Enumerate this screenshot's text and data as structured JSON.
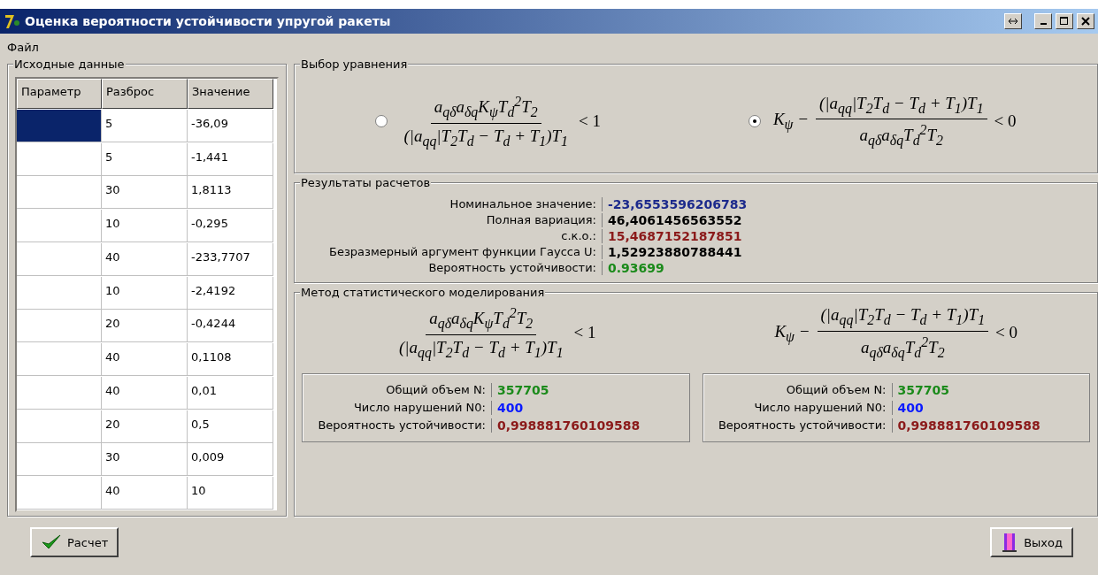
{
  "window": {
    "title": "Оценка вероятности устойчивости упругой ракеты"
  },
  "menu": [
    "Файл"
  ],
  "input_group": {
    "title": "Исходные данные",
    "columns": [
      "Параметр",
      "Разброс",
      "Значение"
    ],
    "rows": [
      {
        "spread": "5",
        "value": "-36,09",
        "selected": true
      },
      {
        "spread": "5",
        "value": "-1,441",
        "selected": false
      },
      {
        "spread": "30",
        "value": "1,8113",
        "selected": false
      },
      {
        "spread": "10",
        "value": "-0,295",
        "selected": false
      },
      {
        "spread": "40",
        "value": "-233,7707",
        "selected": false
      },
      {
        "spread": "10",
        "value": "-2,4192",
        "selected": false
      },
      {
        "spread": "20",
        "value": "-0,4244",
        "selected": false
      },
      {
        "spread": "40",
        "value": "0,1108",
        "selected": false
      },
      {
        "spread": "40",
        "value": "0,01",
        "selected": false
      },
      {
        "spread": "20",
        "value": "0,5",
        "selected": false
      },
      {
        "spread": "30",
        "value": "0,009",
        "selected": false
      },
      {
        "spread": "40",
        "value": "10",
        "selected": false
      }
    ]
  },
  "equation_group": {
    "title": "Выбор уравнения",
    "options": [
      {
        "selected": false,
        "numerator": "a$_{qδ}$a$_{δq}$K$_{ψ}$T$_{d}$$^{2}$T$_{2}$",
        "denominator": "(|a$_{qq}$|T$_{2}$T$_{d}$ − T$_{d}$ + T$_{1}$)T$_{1}$",
        "relation": "< 1"
      },
      {
        "selected": true,
        "prefix": "K$_{ψ}$ −",
        "numerator": "(|a$_{qq}$|T$_{2}$T$_{d}$ − T$_{d}$ + T$_{1}$)T$_{1}$",
        "denominator": "a$_{qδ}$a$_{δq}$T$_{d}$$^{2}$T$_{2}$",
        "relation": "< 0"
      }
    ]
  },
  "results_group": {
    "title": "Результаты расчетов",
    "rows": [
      {
        "label": "Номинальное значение:",
        "value": "-23,6553596206783",
        "color": "#1c2a8c"
      },
      {
        "label": "Полная вариация:",
        "value": "46,4061456563552",
        "color": "#000000"
      },
      {
        "label": "с.к.о.:",
        "value": "15,4687152187851",
        "color": "#8b1a1a"
      },
      {
        "label": "Безразмерный аргумент функции Гаусса U:",
        "value": "1,52923880788441",
        "color": "#000000"
      },
      {
        "label": "Вероятность устойчивости:",
        "value": "0.93699",
        "color": "#1a8a1a"
      }
    ]
  },
  "simulation_group": {
    "title": "Метод статистического моделирования",
    "methods": [
      {
        "numerator": "a$_{qδ}$a$_{δq}$K$_{ψ}$T$_{d}$$^{2}$T$_{2}$",
        "denominator": "(|a$_{qq}$|T$_{2}$T$_{d}$ − T$_{d}$ + T$_{1}$)T$_{1}$",
        "relation": "< 1",
        "rows": [
          {
            "label": "Общий объем N:",
            "value": "357705",
            "color": "#1a8a1a"
          },
          {
            "label": "Число нарушений N0:",
            "value": "400",
            "color": "#0a1aff"
          },
          {
            "label": "Вероятность устойчивости:",
            "value": "0,998881760109588",
            "color": "#8b1a1a"
          }
        ]
      },
      {
        "prefix": "K$_{ψ}$ −",
        "numerator": "(|a$_{qq}$|T$_{2}$T$_{d}$ − T$_{d}$ + T$_{1}$)T$_{1}$",
        "denominator": "a$_{qδ}$a$_{δq}$T$_{d}$$^{2}$T$_{2}$",
        "relation": "< 0",
        "rows": [
          {
            "label": "Общий объем N:",
            "value": "357705",
            "color": "#1a8a1a"
          },
          {
            "label": "Число нарушений N0:",
            "value": "400",
            "color": "#0a1aff"
          },
          {
            "label": "Вероятность устойчивости:",
            "value": "0,998881760109588",
            "color": "#8b1a1a"
          }
        ]
      }
    ]
  },
  "buttons": [
    {
      "kind": "calculate",
      "label": "Расчет"
    },
    {
      "kind": "exit",
      "label": "Выход"
    }
  ]
}
